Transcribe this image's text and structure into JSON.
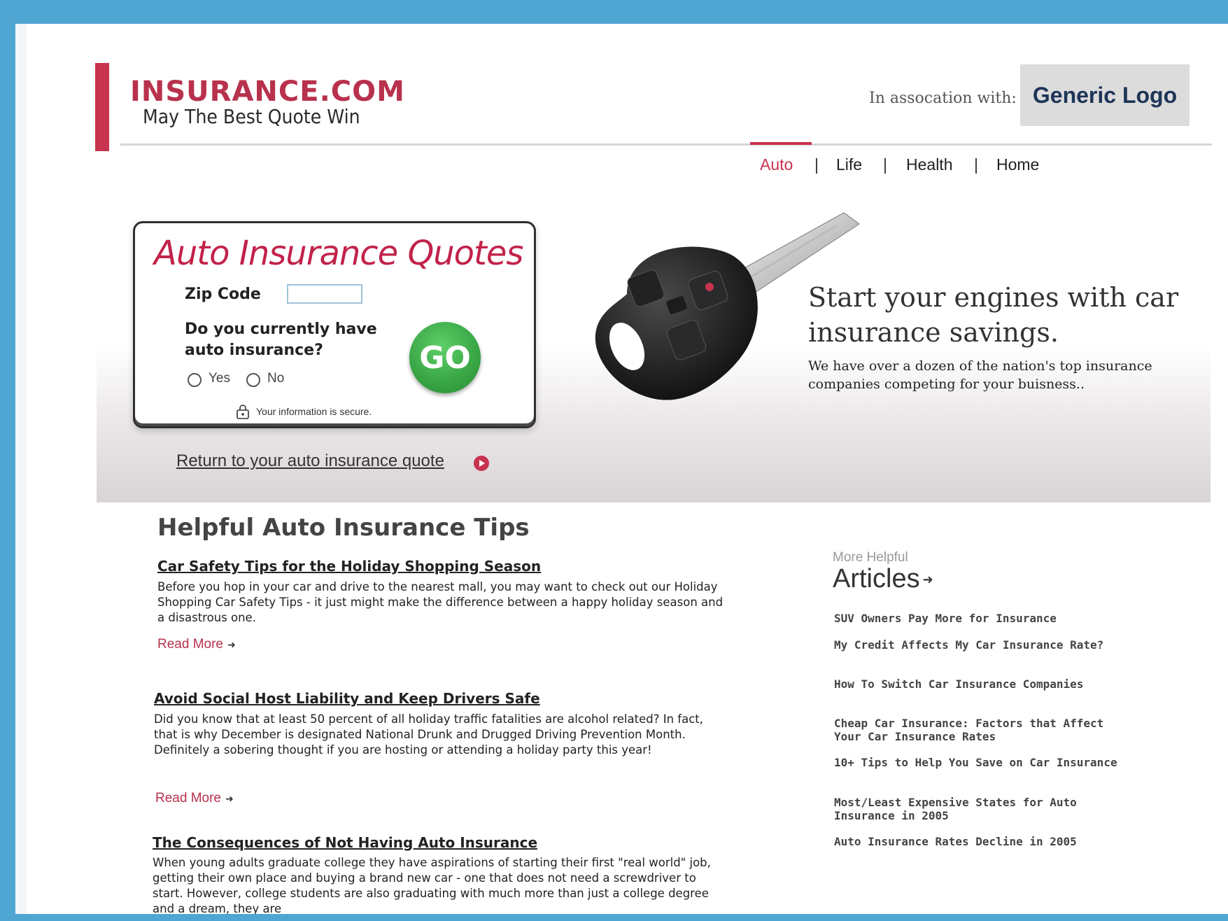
{
  "header": {
    "brand_name": "INSURANCE.COM",
    "tagline": "May The Best Quote Win",
    "association_label": "In assocation with:",
    "partner_logo": "Generic Logo"
  },
  "nav": {
    "items": [
      {
        "label": "Auto",
        "active": true
      },
      {
        "label": "Life"
      },
      {
        "label": "Health"
      },
      {
        "label": "Home"
      }
    ],
    "separator": "|"
  },
  "quote_form": {
    "title": "Auto Insurance Quotes",
    "zip_label": "Zip Code",
    "zip_value": "",
    "question": "Do you currently have auto insurance?",
    "options": [
      "Yes",
      "No"
    ],
    "submit_label": "GO",
    "secure_note": "Your information is secure."
  },
  "hero": {
    "return_link": "Return to your auto insurance quote",
    "headline": "Start your engines with car insurance savings.",
    "subtext": "We have over a dozen of the nation's top insurance companies competing for your buisness.."
  },
  "tips": {
    "heading": "Helpful Auto Insurance Tips",
    "read_more": "Read More",
    "items": [
      {
        "title": "Car Safety Tips for the Holiday Shopping Season",
        "body": "Before you hop in your car and drive to the nearest mall, you may want to check out our Holiday Shopping Car Safety Tips - it just might make the difference between a happy holiday season and a disastrous one."
      },
      {
        "title": "Avoid Social Host Liability and Keep Drivers Safe",
        "body": "Did you know that at least 50 percent of all holiday traffic fatalities are alcohol related? In fact, that is why December is designated National Drunk and Drugged Driving Prevention Month. Definitely a sobering thought if you are hosting or attending a holiday party this year!"
      },
      {
        "title": "The Consequences of Not Having Auto Insurance",
        "body": "When young adults graduate college they have aspirations of starting their first \"real world\" job, getting their own place and buying a brand new car - one that does not need a screwdriver to start. However, college students are also graduating with much more than just a college degree and a dream, they are"
      }
    ]
  },
  "sidebar": {
    "more_label": "More Helpful",
    "title": "Articles",
    "articles": [
      "SUV Owners Pay More for Insurance",
      "My Credit Affects My Car Insurance Rate?",
      "How To Switch Car Insurance Companies",
      "Cheap Car Insurance: Factors that Affect Your Car Insurance Rates",
      "10+ Tips to Help You Save on Car Insurance",
      "Most/Least Expensive States for Auto Insurance in 2005",
      "Auto Insurance Rates Decline in 2005"
    ]
  },
  "colors": {
    "brand": "#c8334f",
    "frame": "#4fa6d3",
    "go_button": "#3aa846"
  }
}
